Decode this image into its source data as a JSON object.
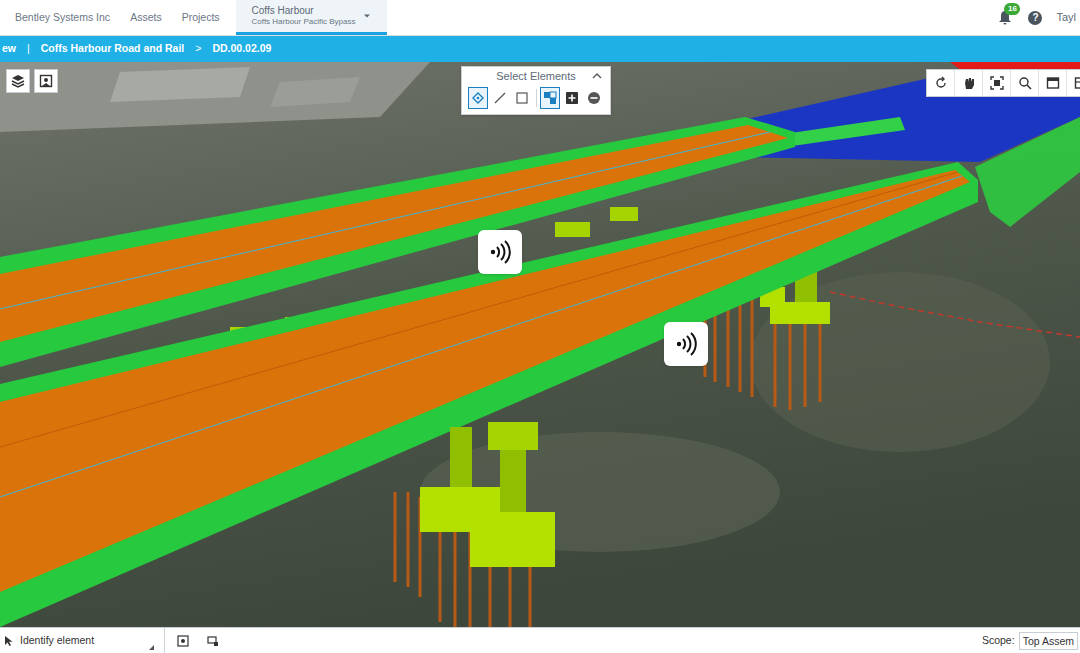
{
  "header": {
    "organization": "Bentley Systems Inc",
    "nav": [
      {
        "label": "Assets",
        "selected": false
      },
      {
        "label": "Projects",
        "selected": false
      }
    ],
    "project_tab": {
      "title": "Coffs Harbour",
      "subtitle": "Coffs Harbour Pacific Bypass",
      "selected": true
    },
    "notifications": {
      "count": "16"
    },
    "help": "?",
    "user": "Tayl"
  },
  "breadcrumb": {
    "items": [
      "ew",
      "|",
      "Coffs Harbour Road and Rail",
      ">",
      "DD.00.02.09"
    ]
  },
  "select_panel": {
    "title": "Select Elements",
    "expanded": true,
    "tools": [
      {
        "kind": "element",
        "selected": true
      },
      {
        "kind": "line",
        "selected": false
      },
      {
        "kind": "box",
        "selected": false
      },
      {
        "kind": "mode",
        "selected": true
      },
      {
        "kind": "add",
        "selected": false
      },
      {
        "kind": "remove",
        "selected": false
      }
    ]
  },
  "markers": [
    {
      "kind": "sound"
    },
    {
      "kind": "sound"
    }
  ],
  "status_bar": {
    "tool": "Identify element",
    "scope_label": "Scope:",
    "scope": "Top Assem"
  }
}
